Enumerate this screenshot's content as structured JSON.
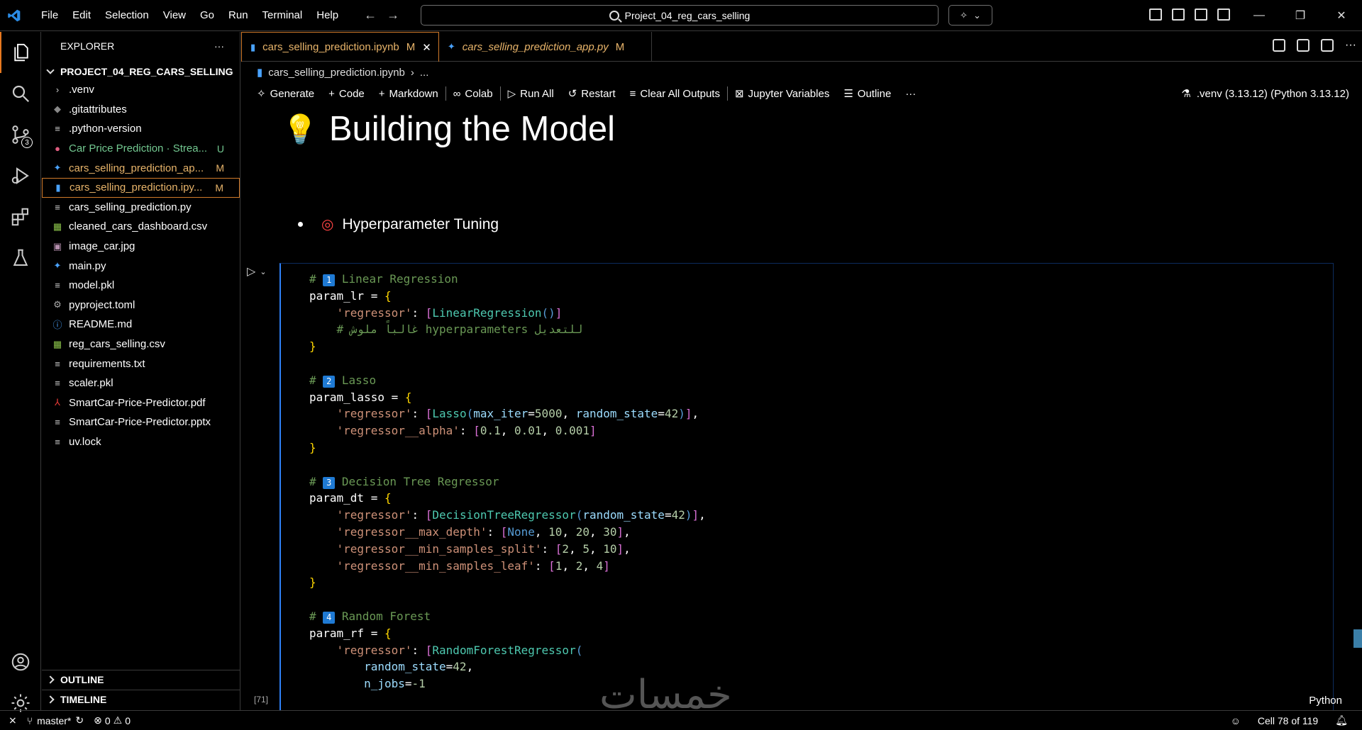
{
  "menu": [
    "File",
    "Edit",
    "Selection",
    "View",
    "Go",
    "Run",
    "Terminal",
    "Help"
  ],
  "search": {
    "text": "Project_04_reg_cars_selling"
  },
  "explorer": {
    "title": "EXPLORER",
    "more": "···",
    "project": "PROJECT_04_REG_CARS_SELLING",
    "files": [
      {
        "name": ".venv",
        "icon": "chevron-right",
        "status": ""
      },
      {
        "name": ".gitattributes",
        "icon": "git",
        "status": ""
      },
      {
        "name": ".python-version",
        "icon": "text",
        "status": ""
      },
      {
        "name": "Car Price Prediction · Strea...",
        "icon": "video",
        "status": "U"
      },
      {
        "name": "cars_selling_prediction_ap...",
        "icon": "python",
        "status": "M"
      },
      {
        "name": "cars_selling_prediction.ipy...",
        "icon": "notebook",
        "status": "M"
      },
      {
        "name": "cars_selling_prediction.py",
        "icon": "text",
        "status": ""
      },
      {
        "name": "cleaned_cars_dashboard.csv",
        "icon": "csv",
        "status": ""
      },
      {
        "name": "image_car.jpg",
        "icon": "image",
        "status": ""
      },
      {
        "name": "main.py",
        "icon": "python",
        "status": ""
      },
      {
        "name": "model.pkl",
        "icon": "text",
        "status": ""
      },
      {
        "name": "pyproject.toml",
        "icon": "gear",
        "status": ""
      },
      {
        "name": "README.md",
        "icon": "info",
        "status": ""
      },
      {
        "name": "reg_cars_selling.csv",
        "icon": "csv",
        "status": ""
      },
      {
        "name": "requirements.txt",
        "icon": "text",
        "status": ""
      },
      {
        "name": "scaler.pkl",
        "icon": "text",
        "status": ""
      },
      {
        "name": "SmartCar-Price-Predictor.pdf",
        "icon": "pdf",
        "status": ""
      },
      {
        "name": "SmartCar-Price-Predictor.pptx",
        "icon": "text",
        "status": ""
      },
      {
        "name": "uv.lock",
        "icon": "text",
        "status": ""
      }
    ],
    "outline": "OUTLINE",
    "timeline": "TIMELINE"
  },
  "tabs": [
    {
      "label": "cars_selling_prediction.ipynb",
      "status": "M",
      "close": "✕"
    },
    {
      "label": "cars_selling_prediction_app.py",
      "status": "M"
    }
  ],
  "breadcrumb": {
    "file": "cars_selling_prediction.ipynb",
    "rest": "..."
  },
  "toolbar": {
    "generate": "Generate",
    "code": "Code",
    "markdown": "Markdown",
    "colab": "Colab",
    "run_all": "Run All",
    "restart": "Restart",
    "clear": "Clear All Outputs",
    "variables": "Jupyter Variables",
    "outline": "Outline",
    "more": "···",
    "kernel": ".venv (3.13.12) (Python 3.13.12)"
  },
  "notebook": {
    "heading": "Building the Model",
    "bullet": "Hyperparameter Tuning",
    "exec_count": "[71]",
    "language": "Python"
  },
  "code": {
    "s1": "Linear Regression",
    "s2": "Lasso",
    "s3": "Decision Tree Regressor",
    "s4": "Random Forest",
    "n1": "1",
    "n2": "2",
    "n3": "3",
    "n4": "4",
    "arabic_comment": "# غالباً ملوش hyperparameters للتعديل"
  },
  "status": {
    "branch": "master*",
    "errors": "0",
    "warnings": "0",
    "cell": "Cell 78 of 119"
  },
  "watermark": "خمسات"
}
